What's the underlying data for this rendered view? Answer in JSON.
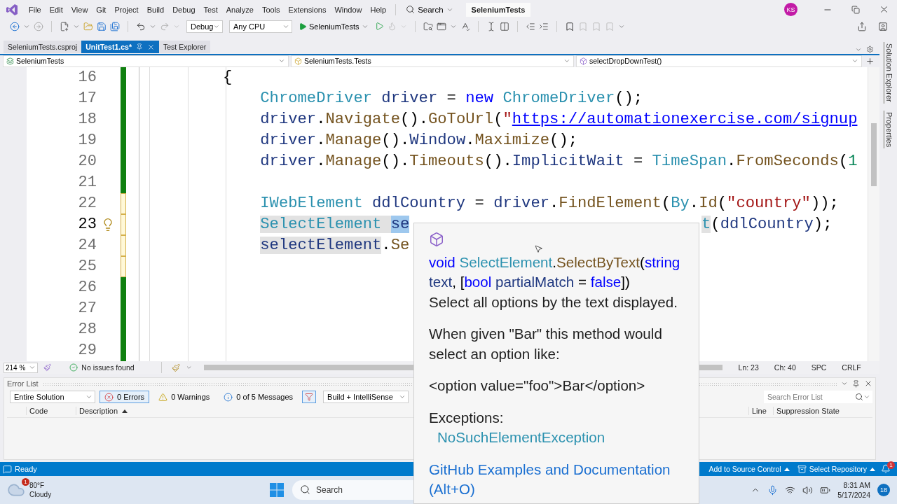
{
  "title_bar": {
    "menus": [
      "File",
      "Edit",
      "View",
      "Git",
      "Project",
      "Build",
      "Debug",
      "Test",
      "Analyze",
      "Tools",
      "Extensions",
      "Window",
      "Help"
    ],
    "search": "Search",
    "solution": "SeleniumTests",
    "avatar": "KS"
  },
  "toolbar": {
    "configuration": "Debug",
    "platform": "Any CPU",
    "start": "SeleniumTests"
  },
  "doc_tabs": [
    {
      "label": "SeleniumTests.csproj",
      "selected": false
    },
    {
      "label": "UnitTest1.cs*",
      "selected": true
    },
    {
      "label": "Test Explorer",
      "selected": false
    }
  ],
  "nav_bar": {
    "project": "SeleniumTests",
    "type": "SeleniumTests.Tests",
    "member": "selectDropDownTest()"
  },
  "side_tabs": [
    "Solution Explorer",
    "Properties"
  ],
  "editor": {
    "lines": [
      {
        "number": "16",
        "modified": false,
        "current": false,
        "tokens": [
          {
            "text": "{",
            "kind": "plain"
          }
        ],
        "children": [
          {
            "number": "17",
            "modified": false,
            "current": false,
            "tokens": [
              {
                "text": "ChromeDriver",
                "kind": "type"
              },
              {
                "text": " driver",
                "kind": "local"
              },
              {
                "text": " = ",
                "kind": "plain"
              },
              {
                "text": "new",
                "kind": "keyword"
              },
              {
                "text": " ChromeDriver",
                "kind": "type"
              },
              {
                "text": "();",
                "kind": "plain"
              }
            ]
          },
          {
            "number": "18",
            "modified": false,
            "current": false,
            "tokens": [
              {
                "text": "driver",
                "kind": "local"
              },
              {
                "text": ".",
                "kind": "plain"
              },
              {
                "text": "Navigate",
                "kind": "method"
              },
              {
                "text": "().",
                "kind": "plain"
              },
              {
                "text": "GoToUrl",
                "kind": "method"
              },
              {
                "text": "(",
                "kind": "plain"
              },
              {
                "text": "\"",
                "kind": "string"
              },
              {
                "text": "https://automationexercise.com/signup",
                "kind": "link"
              }
            ]
          },
          {
            "number": "19",
            "modified": false,
            "current": false,
            "tokens": [
              {
                "text": "driver",
                "kind": "local"
              },
              {
                "text": ".",
                "kind": "plain"
              },
              {
                "text": "Manage",
                "kind": "method"
              },
              {
                "text": "().",
                "kind": "plain"
              },
              {
                "text": "Window",
                "kind": "local"
              },
              {
                "text": ".",
                "kind": "plain"
              },
              {
                "text": "Maximize",
                "kind": "method"
              },
              {
                "text": "();",
                "kind": "plain"
              }
            ]
          },
          {
            "number": "20",
            "modified": false,
            "current": false,
            "tokens": [
              {
                "text": "driver",
                "kind": "local"
              },
              {
                "text": ".",
                "kind": "plain"
              },
              {
                "text": "Manage",
                "kind": "method"
              },
              {
                "text": "().",
                "kind": "plain"
              },
              {
                "text": "Timeouts",
                "kind": "method"
              },
              {
                "text": "().",
                "kind": "plain"
              },
              {
                "text": "ImplicitWait",
                "kind": "local"
              },
              {
                "text": " = ",
                "kind": "plain"
              },
              {
                "text": "TimeSpan",
                "kind": "type"
              },
              {
                "text": ".",
                "kind": "plain"
              },
              {
                "text": "FromSeconds",
                "kind": "method"
              },
              {
                "text": "(",
                "kind": "plain"
              },
              {
                "text": "1",
                "kind": "number"
              }
            ]
          },
          {
            "number": "21",
            "modified": false,
            "current": false
          },
          {
            "number": "22",
            "modified": true,
            "current": false,
            "tokens": [
              {
                "text": "IWebElement",
                "kind": "type"
              },
              {
                "text": " ddlCountry",
                "kind": "local"
              },
              {
                "text": " = ",
                "kind": "plain"
              },
              {
                "text": "driver",
                "kind": "local"
              },
              {
                "text": ".",
                "kind": "plain"
              },
              {
                "text": "FindElement",
                "kind": "method"
              },
              {
                "text": "(",
                "kind": "plain"
              },
              {
                "text": "By",
                "kind": "type"
              },
              {
                "text": ".",
                "kind": "plain"
              },
              {
                "text": "Id",
                "kind": "method"
              },
              {
                "text": "(",
                "kind": "plain"
              },
              {
                "text": "\"country\"",
                "kind": "string"
              },
              {
                "text": "));",
                "kind": "plain"
              }
            ]
          },
          {
            "number": "23",
            "modified": true,
            "current": true,
            "tokens": [
              {
                "text": "SelectElement ",
                "kind": "type",
                "highlighted": true
              },
              {
                "text": "se",
                "kind": "local",
                "selected": true
              }
            ],
            "tail": [
              {
                "text": "t",
                "kind": "type",
                "highlighted": true
              },
              {
                "text": "(",
                "kind": "plain"
              },
              {
                "text": "ddlCountry",
                "kind": "local"
              },
              {
                "text": ");",
                "kind": "plain"
              }
            ]
          },
          {
            "number": "24",
            "modified": true,
            "current": false,
            "tokens": [
              {
                "text": "selectElement",
                "kind": "local",
                "highlighted": true
              },
              {
                "text": ".",
                "kind": "plain"
              },
              {
                "text": "Se",
                "kind": "method"
              }
            ]
          },
          {
            "number": "25",
            "modified": true,
            "current": false
          },
          {
            "number": "26",
            "modified": false,
            "current": false
          },
          {
            "number": "27",
            "modified": false,
            "current": false
          },
          {
            "number": "28",
            "modified": false,
            "current": false
          },
          {
            "number": "29",
            "modified": false,
            "current": false
          }
        ]
      }
    ]
  },
  "editor_status": {
    "zoom": "214 %",
    "issues": "No issues found",
    "line": "Ln: 23",
    "column": "Ch: 40",
    "whitespace": "SPC",
    "line_ending": "CRLF"
  },
  "quick_info": {
    "signature": [
      {
        "text": "void",
        "kind": "keyword"
      },
      {
        "text": " SelectElement",
        "kind": "type"
      },
      {
        "text": ".",
        "kind": "plain"
      },
      {
        "text": "SelectByText",
        "kind": "method"
      },
      {
        "text": "(",
        "kind": "plain"
      },
      {
        "text": "string",
        "kind": "keyword"
      },
      {
        "text": " text",
        "kind": "local"
      },
      {
        "text": ", [",
        "kind": "plain"
      },
      {
        "text": "bool",
        "kind": "keyword"
      },
      {
        "text": " partialMatch",
        "kind": "local"
      },
      {
        "text": " = ",
        "kind": "plain"
      },
      {
        "text": "false",
        "kind": "keyword"
      },
      {
        "text": "])",
        "kind": "plain"
      }
    ],
    "summary": "Select all options by the text displayed.",
    "remarks": "When given \"Bar\" this method would select an option like:",
    "example": "<option value=\"foo\">Bar</option>",
    "exceptions_label": "Exceptions:",
    "exceptions": [
      "NoSuchElementException"
    ],
    "docs_link": "GitHub Examples and Documentation (Alt+O)"
  },
  "error_list": {
    "title": "Error List",
    "scope": "Entire Solution",
    "filters": [
      {
        "kind": "error",
        "label": "0 Errors",
        "selected": true
      },
      {
        "kind": "warning",
        "label": "0 Warnings",
        "selected": false
      },
      {
        "kind": "info",
        "label": "0 of 5 Messages",
        "selected": false
      }
    ],
    "source": "Build + IntelliSense",
    "search_placeholder": "Search Error List",
    "columns": [
      "Code",
      "Description"
    ],
    "trailing_columns": [
      "Line",
      "Suppression State"
    ]
  },
  "status_bar": {
    "state": "Ready",
    "source_control": "Add to Source Control",
    "repository": "Select Repository",
    "notifications": "1"
  },
  "taskbar": {
    "temperature": "80°F",
    "condition": "Cloudy",
    "weather_badge": "1",
    "search_placeholder": "Search",
    "time": "8:31 AM",
    "date": "5/17/2024",
    "notifications": "18"
  }
}
